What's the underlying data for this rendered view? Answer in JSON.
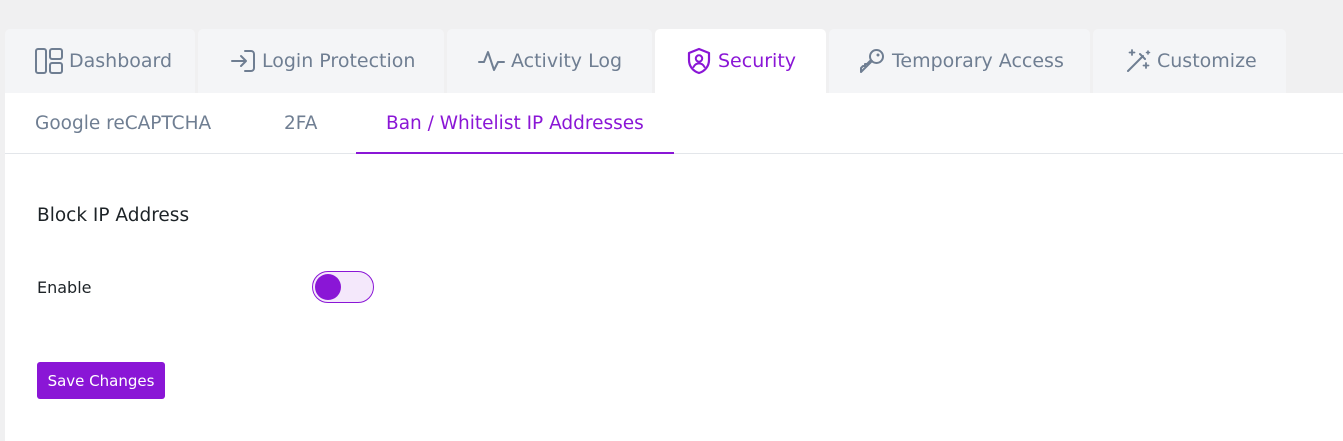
{
  "top_tabs": [
    {
      "label": "Dashboard",
      "icon": "dashboard-icon",
      "active": false
    },
    {
      "label": "Login Protection",
      "icon": "login-icon",
      "active": false
    },
    {
      "label": "Activity Log",
      "icon": "activity-icon",
      "active": false
    },
    {
      "label": "Security",
      "icon": "shield-icon",
      "active": true
    },
    {
      "label": "Temporary Access",
      "icon": "key-icon",
      "active": false
    },
    {
      "label": "Customize",
      "icon": "magic-wand-icon",
      "active": false
    }
  ],
  "sub_tabs": [
    {
      "label": "Google reCAPTCHA",
      "active": false
    },
    {
      "label": "2FA",
      "active": false
    },
    {
      "label": "Ban / Whitelist IP Addresses",
      "active": true
    }
  ],
  "section": {
    "title": "Block IP Address",
    "enable_label": "Enable",
    "enable_on": false
  },
  "save_label": "Save Changes",
  "colors": {
    "accent": "#8a16d6",
    "inactive_text": "#6f7e92",
    "tab_background": "#f4f5f7",
    "page_background": "#f0f0f1"
  }
}
